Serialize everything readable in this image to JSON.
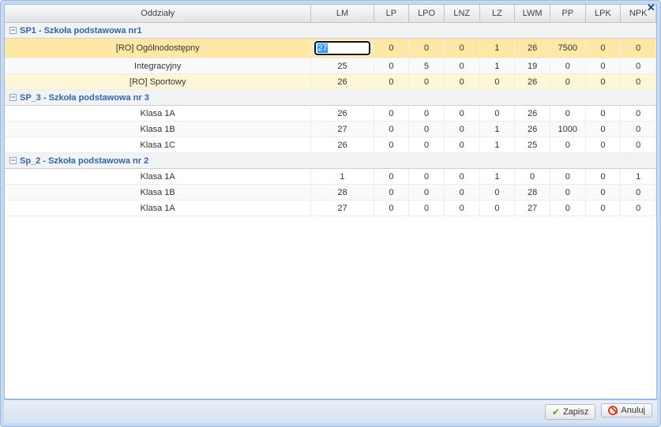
{
  "window": {
    "close_tooltip": "Zamknij"
  },
  "columns": [
    "Oddziały",
    "LM",
    "LP",
    "LPO",
    "LNZ",
    "LZ",
    "LWM",
    "PP",
    "LPK",
    "NPK"
  ],
  "groups": [
    {
      "label": "SP1 - Szkoła podstawowa nr1",
      "rows": [
        {
          "name": "[RO] Ogólnodostępny",
          "ro": true,
          "selected": true,
          "editCol": "LM",
          "LM": "27",
          "LP": "0",
          "LPO": "0",
          "LNZ": "0",
          "LZ": "1",
          "LWM": "26",
          "PP": "7500",
          "LPK": "0",
          "NPK": "0"
        },
        {
          "name": "Integracyjny",
          "LM": "25",
          "LP": "0",
          "LPO": "5",
          "LNZ": "0",
          "LZ": "1",
          "LWM": "19",
          "PP": "0",
          "LPK": "0",
          "NPK": "0"
        },
        {
          "name": "[RO] Sportowy",
          "ro": true,
          "LM": "26",
          "LP": "0",
          "LPO": "0",
          "LNZ": "0",
          "LZ": "0",
          "LWM": "26",
          "PP": "0",
          "LPK": "0",
          "NPK": "0"
        }
      ]
    },
    {
      "label": "SP_3 - Szkoła podstawowa nr 3",
      "rows": [
        {
          "name": "Klasa 1A",
          "LM": "26",
          "LP": "0",
          "LPO": "0",
          "LNZ": "0",
          "LZ": "0",
          "LWM": "26",
          "PP": "0",
          "LPK": "0",
          "NPK": "0"
        },
        {
          "name": "Klasa 1B",
          "LM": "27",
          "LP": "0",
          "LPO": "0",
          "LNZ": "0",
          "LZ": "1",
          "LWM": "26",
          "PP": "1000",
          "LPK": "0",
          "NPK": "0"
        },
        {
          "name": "Klasa 1C",
          "LM": "26",
          "LP": "0",
          "LPO": "0",
          "LNZ": "0",
          "LZ": "1",
          "LWM": "25",
          "PP": "0",
          "LPK": "0",
          "NPK": "0"
        }
      ]
    },
    {
      "label": "Sp_2 - Szkoła podstawowa nr 2",
      "rows": [
        {
          "name": "Klasa 1A",
          "LM": "1",
          "LP": "0",
          "LPO": "0",
          "LNZ": "0",
          "LZ": "1",
          "LWM": "0",
          "PP": "0",
          "LPK": "0",
          "NPK": "1"
        },
        {
          "name": "Klasa 1B",
          "LM": "28",
          "LP": "0",
          "LPO": "0",
          "LNZ": "0",
          "LZ": "0",
          "LWM": "28",
          "PP": "0",
          "LPK": "0",
          "NPK": "0"
        },
        {
          "name": "Klasa 1A",
          "LM": "27",
          "LP": "0",
          "LPO": "0",
          "LNZ": "0",
          "LZ": "0",
          "LWM": "27",
          "PP": "0",
          "LPK": "0",
          "NPK": "0"
        }
      ]
    }
  ],
  "buttons": {
    "save": "Zapisz",
    "cancel": "Anuluj"
  }
}
